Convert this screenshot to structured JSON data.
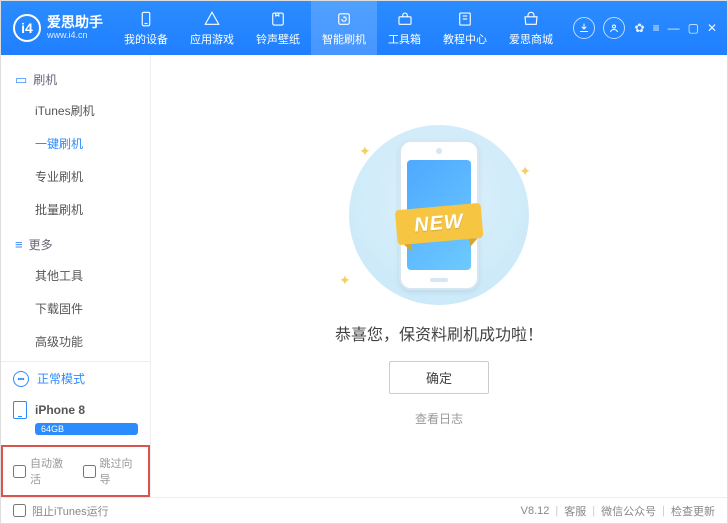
{
  "app": {
    "title": "爱思助手",
    "url": "www.i4.cn"
  },
  "header": {
    "tabs": [
      {
        "label": "我的设备",
        "icon": "phone"
      },
      {
        "label": "应用游戏",
        "icon": "apps"
      },
      {
        "label": "铃声壁纸",
        "icon": "note"
      },
      {
        "label": "智能刷机",
        "icon": "refresh",
        "active": true
      },
      {
        "label": "工具箱",
        "icon": "toolbox"
      },
      {
        "label": "教程中心",
        "icon": "book"
      },
      {
        "label": "爱思商城",
        "icon": "shop"
      }
    ]
  },
  "sidebar": {
    "sections": [
      {
        "title": "刷机",
        "items": [
          {
            "label": "iTunes刷机"
          },
          {
            "label": "一键刷机",
            "active": true
          },
          {
            "label": "专业刷机"
          },
          {
            "label": "批量刷机"
          }
        ]
      },
      {
        "title": "更多",
        "items": [
          {
            "label": "其他工具"
          },
          {
            "label": "下载固件"
          },
          {
            "label": "高级功能"
          }
        ]
      }
    ],
    "mode": "正常模式",
    "device": {
      "name": "iPhone 8",
      "storage": "64GB"
    },
    "checks": {
      "autoActivate": "自动激活",
      "skipWizard": "跳过向导"
    }
  },
  "content": {
    "ribbon": "NEW",
    "successText": "恭喜您，保资料刷机成功啦！",
    "okButton": "确定",
    "logLink": "查看日志"
  },
  "footer": {
    "blockItunes": "阻止iTunes运行",
    "version": "V8.12",
    "links": {
      "service": "客服",
      "wechat": "微信公众号",
      "update": "检查更新"
    }
  }
}
